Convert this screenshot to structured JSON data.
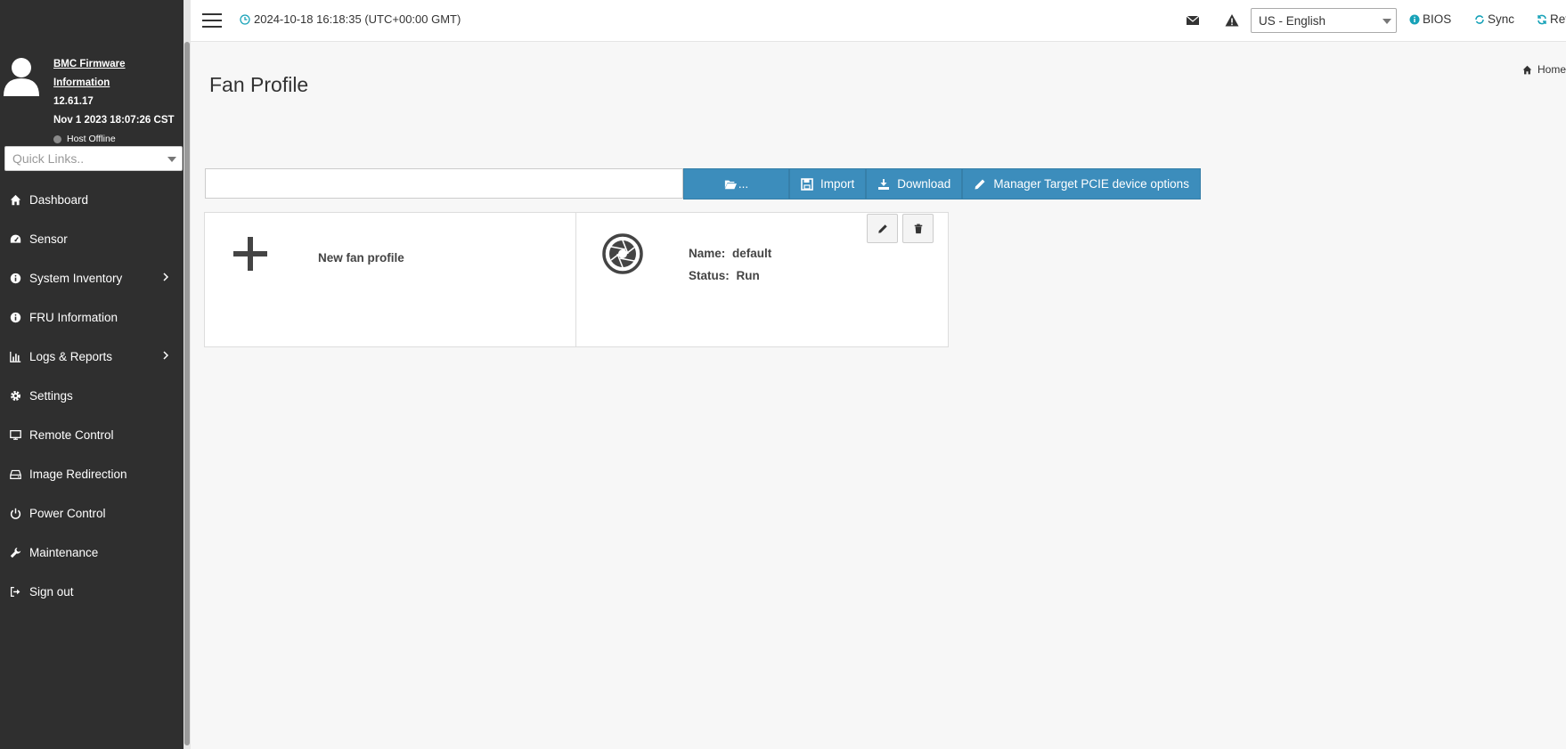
{
  "colors": {
    "sidebar_bg": "#2f2f2f",
    "accent": "#3c8dbc",
    "teal_icon": "#17a2b8"
  },
  "firmware": {
    "title": "BMC Firmware Information",
    "version": "12.61.17",
    "build_date": "Nov 1 2023 18:07:26 CST",
    "host_status": "Host Offline"
  },
  "quicklinks": {
    "placeholder": "Quick Links.."
  },
  "sidebar": {
    "items": [
      {
        "label": "Dashboard",
        "icon": "home-icon"
      },
      {
        "label": "Sensor",
        "icon": "gauge-icon"
      },
      {
        "label": "System Inventory",
        "icon": "info-icon",
        "expandable": true
      },
      {
        "label": "FRU Information",
        "icon": "info-icon"
      },
      {
        "label": "Logs & Reports",
        "icon": "bar-chart-icon",
        "expandable": true
      },
      {
        "label": "Settings",
        "icon": "gear-icon"
      },
      {
        "label": "Remote Control",
        "icon": "monitor-icon"
      },
      {
        "label": "Image Redirection",
        "icon": "drive-icon"
      },
      {
        "label": "Power Control",
        "icon": "power-icon"
      },
      {
        "label": "Maintenance",
        "icon": "wrench-icon"
      },
      {
        "label": "Sign out",
        "icon": "sign-out-icon"
      }
    ]
  },
  "topbar": {
    "datetime": "2024-10-18 16:18:35 (UTC+00:00 GMT)",
    "language": "US - English",
    "bios_label": "BIOS",
    "sync_label": "Sync",
    "refresh_label": "Refresh"
  },
  "breadcrumb": {
    "home": "Home"
  },
  "page": {
    "title": "Fan Profile"
  },
  "upload": {
    "browse_label": "...",
    "import_label": "Import",
    "download_label": "Download",
    "manager_label": "Manager Target PCIE device options"
  },
  "cards": {
    "new_label": "New fan profile",
    "profile": {
      "name_label": "Name:",
      "name_value": "default",
      "status_label": "Status:",
      "status_value": "Run"
    }
  }
}
